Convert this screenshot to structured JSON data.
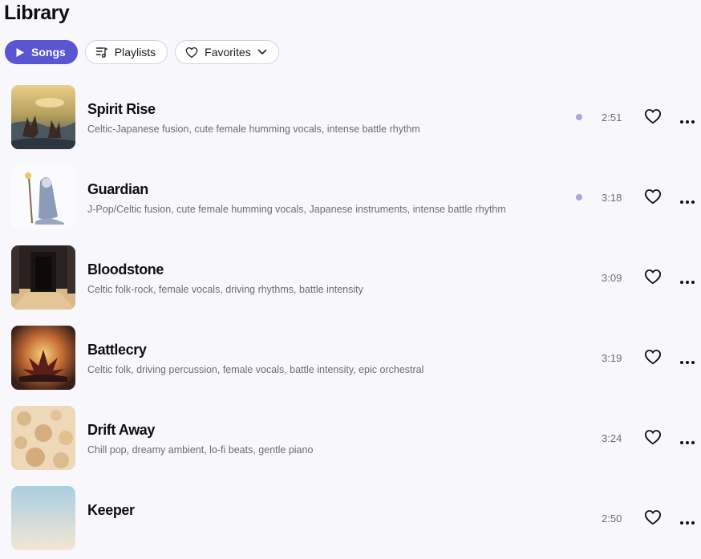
{
  "page": {
    "title": "Library"
  },
  "tabs": [
    {
      "label": "Songs",
      "icon": "play-icon",
      "active": true
    },
    {
      "label": "Playlists",
      "icon": "playlist-icon",
      "active": false
    },
    {
      "label": "Favorites",
      "icon": "heart-icon",
      "active": false,
      "dropdown": "chevron-down-icon"
    }
  ],
  "songs": [
    {
      "title": "Spirit Rise",
      "description": "Celtic-Japanese fusion, cute female humming vocals, intense battle rhythm",
      "duration": "2:51",
      "new_indicator": true
    },
    {
      "title": "Guardian",
      "description": "J-Pop/Celtic fusion, cute female humming vocals, Japanese instruments, intense battle rhythm",
      "duration": "3:18",
      "new_indicator": true
    },
    {
      "title": "Bloodstone",
      "description": "Celtic folk-rock, female vocals, driving rhythms, battle intensity",
      "duration": "3:09",
      "new_indicator": false
    },
    {
      "title": "Battlecry",
      "description": "Celtic folk, driving percussion, female vocals, battle intensity, epic orchestral",
      "duration": "3:19",
      "new_indicator": false
    },
    {
      "title": "Drift Away",
      "description": "Chill pop, dreamy ambient, lo-fi beats, gentle piano",
      "duration": "3:24",
      "new_indicator": false
    },
    {
      "title": "Keeper",
      "description": "",
      "duration": "2:50",
      "new_indicator": false
    }
  ],
  "colors": {
    "accent": "#5a55d1",
    "indicator": "#a7a9dc",
    "background": "#f8f8fc"
  }
}
